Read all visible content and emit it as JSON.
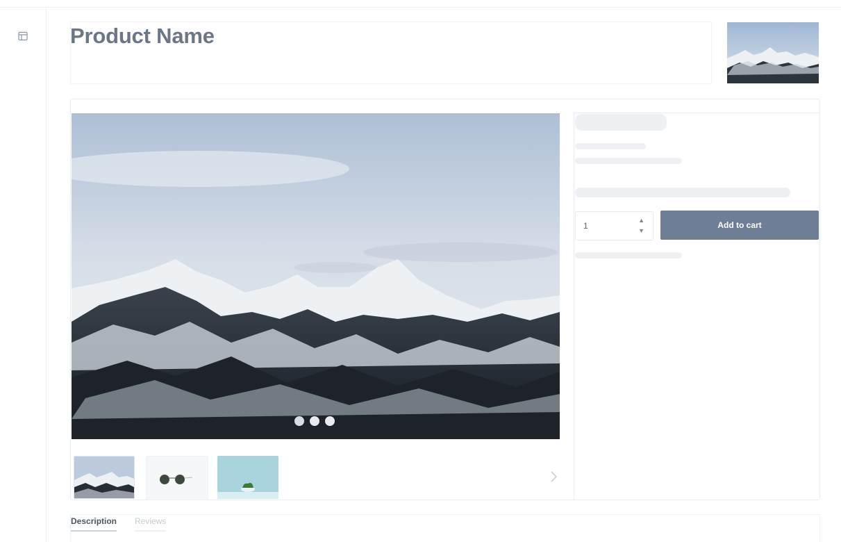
{
  "header": {
    "title": "Product Name"
  },
  "gallery": {
    "dots": 3,
    "active_dot": 1,
    "thumbnails": [
      "mountain-thumbnail",
      "sunglasses-thumbnail",
      "plant-thumbnail"
    ]
  },
  "purchase": {
    "quantity": "1",
    "add_to_cart_label": "Add to cart"
  },
  "tabs": [
    {
      "label": "Description",
      "active": true
    },
    {
      "label": "Reviews",
      "active": false
    }
  ],
  "icons": {
    "sidebar": "layout-icon",
    "next": "chevron-right-icon",
    "qty_up": "chevron-up-icon",
    "qty_down": "chevron-down-icon"
  },
  "colors": {
    "button": "#6f7e97",
    "title": "#6b7689",
    "border": "#e6edf8"
  }
}
